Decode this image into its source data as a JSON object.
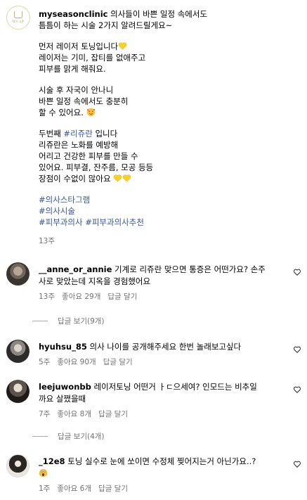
{
  "post": {
    "username": "myseasonclinic",
    "logo_text": "마이 시즌",
    "lines": [
      "의사들이 바쁜 일정 속에서도",
      "틈틈이 하는 시술 2가지 알려드릴게요~",
      "",
      "먼저 레이저 토닝입니다",
      "레이저는 기미, 잡티를 없애주고",
      "피부를 맑게 해줘요.",
      "",
      "시술 후 자국이 안나니",
      "바쁜 일정 속에서도 충분히",
      "할 수 있어요.",
      "",
      "두번째 ",
      "리쥬란은 노화를 예방해",
      "어리고 건강한 피부를 만들 수",
      "있어요. 피부결, 잔주름, 모공 등등",
      "장점이 수없이 많아요"
    ],
    "inline_tag": "#리쥬란",
    "inline_tag_suffix": " 입니다",
    "hashtags": [
      "#의사스타그램",
      "#의사시술",
      "#피부과의사",
      "#피부과의사추천"
    ],
    "age": "13주"
  },
  "comments": [
    {
      "username": "__anne_or_annie",
      "text_line1": "기계로 리쥬란 맞으면 통증은 어떤가요? 손주",
      "text_line2": "사로 맞았는데 지옥을 경험했어요",
      "age": "13주",
      "likes": "좋아요 29개",
      "reply": "답글 달기",
      "view_replies": "답글 보기(9개)"
    },
    {
      "username": "hyuhsu_85",
      "text_line1": "의사 나이를 공개해주세요 한번 놀래보고싶다",
      "age": "5주",
      "likes": "좋아요 90개",
      "reply": "답글 달기"
    },
    {
      "username": "leejuwonbb",
      "text_line1": "레이저토닝 어떤거 ㅏㄷ으세여? 인모드는 비추일",
      "text_line2": "까요 살쪘을때",
      "age": "7주",
      "likes": "좋아요 8개",
      "reply": "답글 달기",
      "view_replies": "답글 보기(4개)"
    },
    {
      "username": "_12e8",
      "text_line1": "토닝 실수로 눈에 쏘이면 수정체 찢어지는거 아닌가요..?",
      "age": "1주",
      "likes": "좋아요 6개",
      "reply": "답글 달기"
    }
  ],
  "icons": {
    "heart": "heart-outline-icon",
    "emoji_yellow_heart": "yellow-heart-emoji",
    "emoji_smile": "smiling-face-hearts-emoji",
    "emoji_scream": "screaming-face-emoji"
  },
  "colors": {
    "hashtag": "#385898",
    "meta_text": "#737373",
    "yellow_heart": "#f7d02c"
  }
}
